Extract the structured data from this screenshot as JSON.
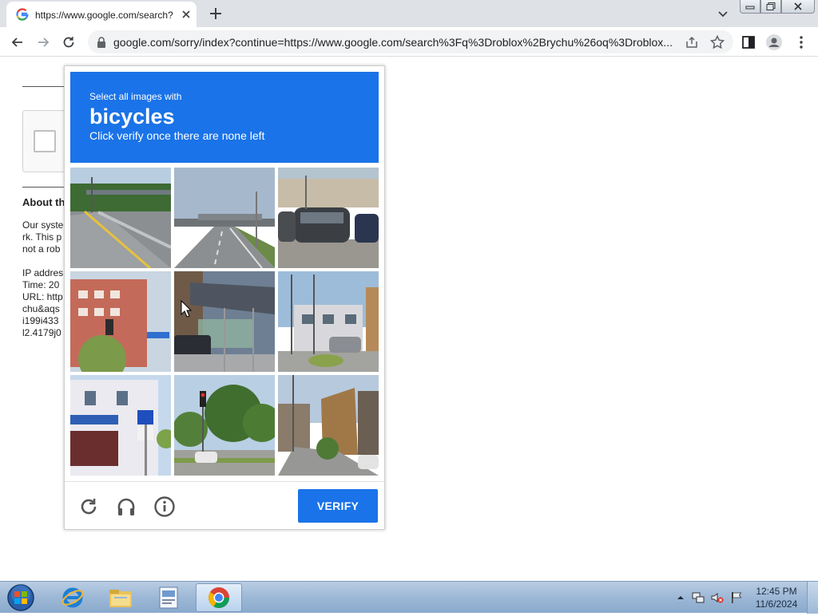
{
  "browser": {
    "tab": {
      "title": "https://www.google.com/search?",
      "favicon": "google-g-icon"
    },
    "url": "google.com/sorry/index?continue=https://www.google.com/search%3Fq%3Droblox%2Brychu%26oq%3Droblox...",
    "icons": [
      "back-icon",
      "forward-icon",
      "reload-icon",
      "lock-icon",
      "share-icon",
      "star-icon",
      "side-panel-icon",
      "profile-icon",
      "menu-icon",
      "tab-search-icon",
      "minimize-icon",
      "maximize-icon",
      "close-icon"
    ]
  },
  "page": {
    "about_heading": "About th",
    "lines": [
      "Our syste",
      "rk. This p",
      "not a rob",
      "",
      "IP addres",
      "Time: 20",
      "URL: http",
      "chu&aqs",
      "i199i433",
      "l2.4179j0"
    ]
  },
  "captcha": {
    "header_small": "Select all images with",
    "header_big": "bicycles",
    "header_sub": "Click verify once there are none left",
    "header_color": "#1a73e8",
    "tiles": [
      "overpass-highway",
      "road-under-bridge",
      "parked-cars",
      "red-building-street",
      "bus-stop-shelter",
      "residential-street",
      "white-building-parking-sign",
      "traffic-light-trees",
      "narrow-residential-road"
    ],
    "footer_icons": [
      "reload-icon",
      "audio-headphones-icon",
      "info-icon"
    ],
    "verify_label": "VERIFY"
  },
  "taskbar": {
    "apps": [
      "start-orb-icon",
      "internet-explorer-icon",
      "file-explorer-icon",
      "media-center-icon",
      "chrome-icon"
    ],
    "tray_icons": [
      "show-hidden-icons-arrow",
      "network-icon",
      "volume-muted-icon",
      "action-center-flag-icon"
    ],
    "time": "12:45 PM",
    "date": "11/6/2024"
  }
}
